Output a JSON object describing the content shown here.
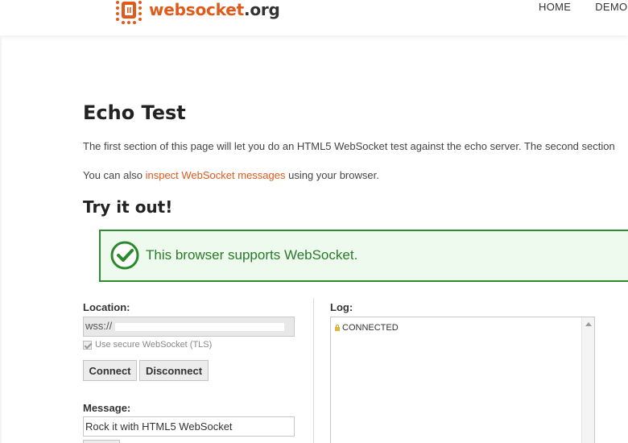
{
  "header": {
    "logo_web": "websocket",
    "logo_org": ".org",
    "nav": [
      "HOME",
      "DEMOS"
    ]
  },
  "main": {
    "title": "Echo Test",
    "intro": "The first section of this page will let you do an HTML5 WebSocket test against the echo server. The second section",
    "also_prefix": "You can also ",
    "also_link": "inspect WebSocket messages",
    "also_suffix": " using your browser.",
    "try_title": "Try it out!",
    "support_message": "This browser supports WebSocket."
  },
  "form": {
    "location_label": "Location:",
    "location_value": "wss://",
    "tls_label": "Use secure WebSocket (TLS)",
    "tls_checked": true,
    "connect_label": "Connect",
    "disconnect_label": "Disconnect",
    "message_label": "Message:",
    "message_value": "Rock it with HTML5 WebSocket"
  },
  "log": {
    "label": "Log:",
    "entries": [
      "CONNECTED"
    ]
  },
  "colors": {
    "accent": "#e05a1c",
    "success_border": "#2e8b2e",
    "success_bg": "#eefaee",
    "success_text": "#2a7a2a"
  }
}
